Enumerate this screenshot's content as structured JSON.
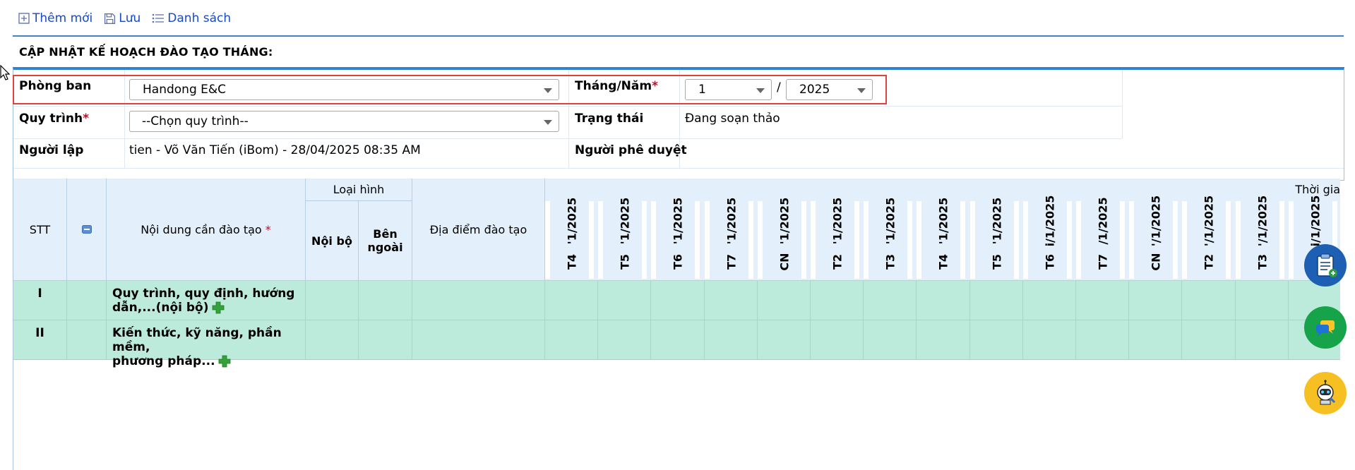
{
  "toolbar": {
    "add_label": "Thêm mới",
    "save_label": "Lưu",
    "list_label": "Danh sách"
  },
  "section_title": "CẬP NHẬT KẾ HOẠCH ĐÀO TẠO THÁNG:",
  "form": {
    "department_label": "Phòng ban",
    "department_value": "Handong E&C",
    "month_year_label": "Tháng/Năm",
    "month_value": "1",
    "separator": "/",
    "year_value": "2025",
    "process_label": "Quy trình",
    "process_value": "--Chọn quy trình--",
    "status_label": "Trạng thái",
    "status_value": "Đang soạn thảo",
    "creator_label": "Người lập",
    "creator_value": "tien - Võ Văn Tiến (iBom) - 28/04/2025 08:35 AM",
    "approver_label": "Người phê duyệt",
    "approver_value": "",
    "required_mark": "*"
  },
  "grid": {
    "col_stt": "STT",
    "col_content": "Nội dung cần đào tạo",
    "col_type_group": "Loại hình",
    "col_internal": "Nội bộ",
    "col_external": "Bên ngoài",
    "col_location": "Địa điểm đào tạo",
    "col_time_group": "Thời gia",
    "date_columns": [
      {
        "date": "'1/2025",
        "day": "T4"
      },
      {
        "date": "'1/2025",
        "day": "T5"
      },
      {
        "date": "'1/2025",
        "day": "T6"
      },
      {
        "date": "'1/2025",
        "day": "T7"
      },
      {
        "date": "'1/2025",
        "day": "CN"
      },
      {
        "date": "'1/2025",
        "day": "T2"
      },
      {
        "date": "'1/2025",
        "day": "T3"
      },
      {
        "date": "'1/2025",
        "day": "T4"
      },
      {
        "date": "'1/2025",
        "day": "T5"
      },
      {
        "date": "i/1/2025",
        "day": "T6"
      },
      {
        "date": "/1/2025",
        "day": "T7"
      },
      {
        "date": "'/1/2025",
        "day": "CN"
      },
      {
        "date": "'/1/2025",
        "day": "T2"
      },
      {
        "date": "'/1/2025",
        "day": "T3"
      },
      {
        "date": "i/1/2025",
        "day": ""
      }
    ],
    "rows": [
      {
        "stt": "I",
        "content_line1": "Quy trình, quy định, hướng",
        "content_line2": "dẫn,...(nội bộ)"
      },
      {
        "stt": "II",
        "content_line1": "Kiến thức, kỹ năng, phần mềm,",
        "content_line2": "phương pháp..."
      }
    ]
  },
  "colors": {
    "accent": "#2f83d3",
    "header_bg": "#e3f0fb",
    "row_bg": "#bceadb",
    "highlight_border": "#e0413a",
    "link": "#1a49c7"
  },
  "icons": {
    "add": "plus-box-icon",
    "save": "floppy-icon",
    "list": "list-icon",
    "fab1": "clipboard-add-icon",
    "fab2": "chat-icon",
    "fab3": "robot-support-icon"
  }
}
